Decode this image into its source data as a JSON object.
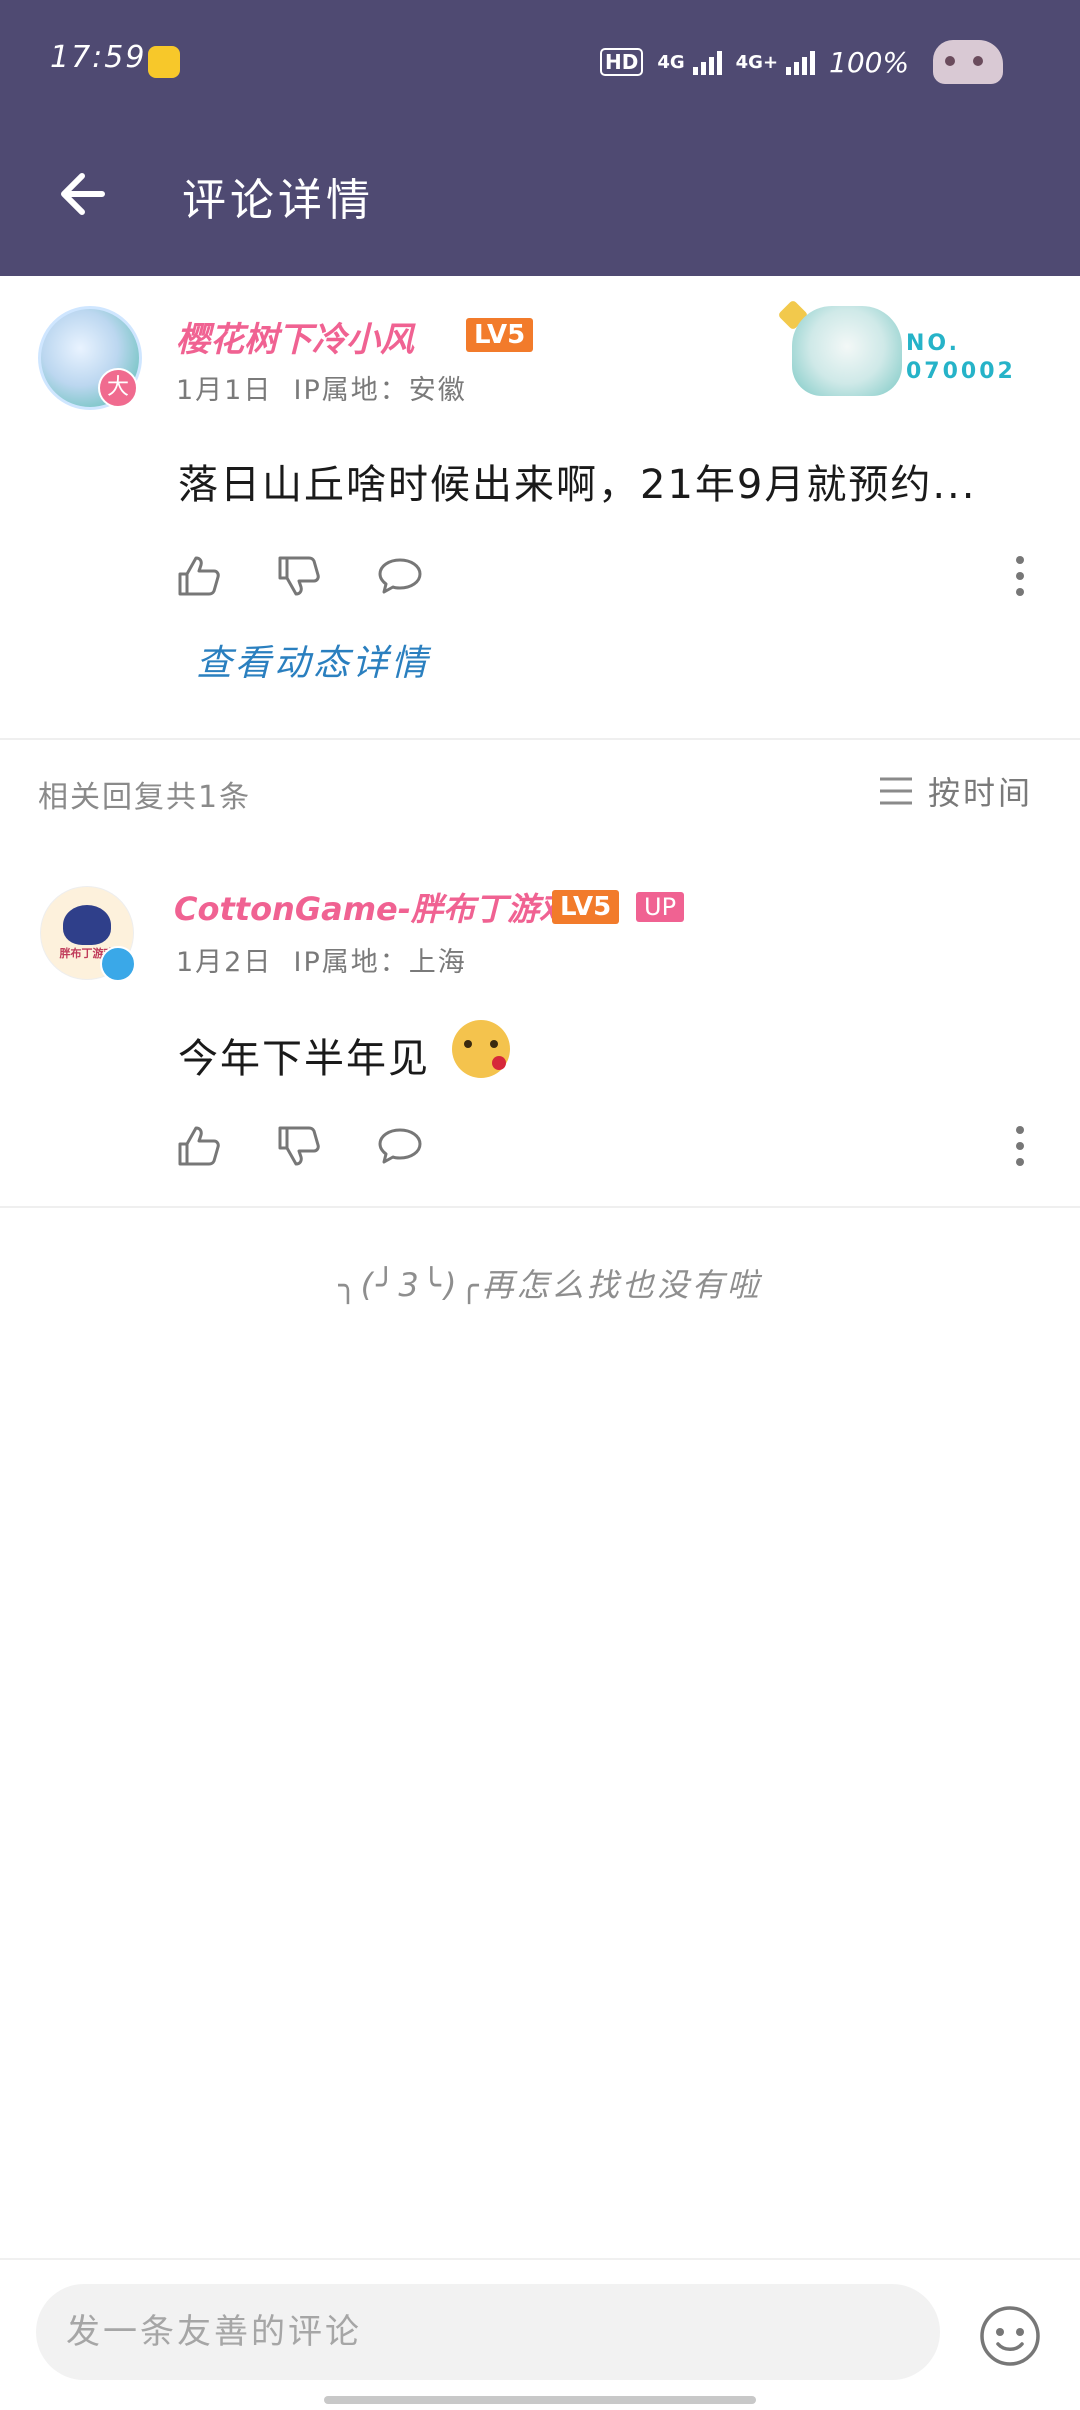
{
  "status_bar": {
    "time": "17:59",
    "hd": "HD",
    "net1": "4G",
    "net2": "4G+",
    "battery": "100%"
  },
  "header": {
    "title": "评论详情"
  },
  "main_comment": {
    "username": "樱花树下冷小风",
    "level": "LV5",
    "avatar_badge": "大",
    "date": "1月1日",
    "ip_location": "IP属地：安徽",
    "fan_card_no": "NO.",
    "fan_card_number": "070002",
    "text": "落日山丘啥时候出来啊，21年9月就预约...",
    "view_dynamic": "查看动态详情"
  },
  "replies_header": {
    "count_label": "相关回复共1条",
    "sort_label": "按时间"
  },
  "reply": {
    "username": "CottonGame-胖布丁游戏",
    "level": "LV5",
    "up_badge": "UP",
    "avatar_text": "胖布丁游戏",
    "date": "1月2日",
    "ip_location": "IP属地：上海",
    "text": "今年下半年见"
  },
  "end_text": "╮(╯3╰)╭再怎么找也没有啦",
  "bottom": {
    "input_placeholder": "发一条友善的评论"
  },
  "colors": {
    "header_bg": "#4f4a72",
    "username_pink": "#f06292",
    "level_orange": "#f27b2b",
    "link_blue": "#2a7fbf"
  }
}
